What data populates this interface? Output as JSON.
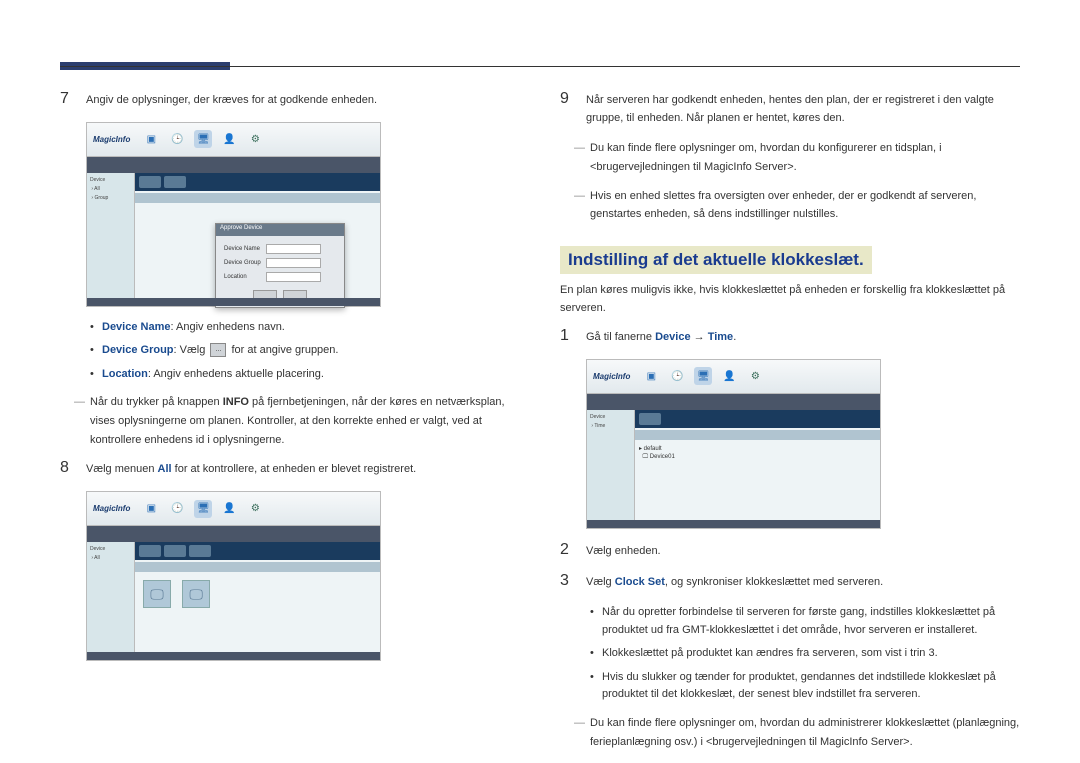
{
  "header": {},
  "left": {
    "step7": {
      "num": "7",
      "text": "Angiv de oplysninger, der kræves for at godkende enheden."
    },
    "screenshot1": {
      "logo": "MagicInfo",
      "dialog_title": "Approve Device",
      "field1_label": "Device Name",
      "field2_label": "Device Group",
      "field3_label": "Location",
      "btn_ok": "OK",
      "btn_cancel": "Cancel"
    },
    "bullets1": {
      "device_name_label": "Device Name",
      "device_name_text": ": Angiv enhedens navn.",
      "device_group_label": "Device Group",
      "device_group_text1": ": Vælg ",
      "device_group_text2": " for at angive gruppen.",
      "group_icon": "...",
      "location_label": "Location",
      "location_text": ": Angiv enhedens aktuelle placering."
    },
    "note1_pre": "Når du trykker på knappen ",
    "note1_info": "INFO",
    "note1_post": " på fjernbetjeningen, når der køres en netværksplan, vises oplysningerne om planen. Kontroller, at den korrekte enhed er valgt, ved at kontrollere enhedens id i oplysningerne.",
    "step8": {
      "num": "8",
      "text_pre": "Vælg menuen ",
      "text_all": "All",
      "text_post": " for at kontrollere, at enheden er blevet registreret."
    },
    "screenshot2": {
      "logo": "MagicInfo"
    }
  },
  "right": {
    "step9": {
      "num": "9",
      "text": "Når serveren har godkendt enheden, hentes den plan, der er registreret i den valgte gruppe, til enheden. Når planen er hentet, køres den."
    },
    "note2": "Du kan finde flere oplysninger om, hvordan du konfigurerer en tidsplan, i <brugervejledningen til MagicInfo Server>.",
    "note3": "Hvis en enhed slettes fra oversigten over enheder, der er godkendt af serveren, genstartes enheden, så dens indstillinger nulstilles.",
    "heading": "Indstilling af det aktuelle klokkeslæt.",
    "subhead": "En plan køres muligvis ikke, hvis klokkeslættet på enheden er forskellig fra klokkeslættet på serveren.",
    "step1": {
      "num": "1",
      "text_pre": "Gå til fanerne ",
      "device": "Device",
      "arrow": " → ",
      "time": "Time",
      "text_post": "."
    },
    "screenshot3": {
      "logo": "MagicInfo",
      "tab_device": "Device",
      "tab_time": "Time"
    },
    "step2": {
      "num": "2",
      "text": "Vælg enheden."
    },
    "step3": {
      "num": "3",
      "text_pre": "Vælg ",
      "clock_set": "Clock Set",
      "text_post": ", og synkroniser klokkeslættet med serveren."
    },
    "bullets2": {
      "b1": "Når du opretter forbindelse til serveren for første gang, indstilles klokkeslættet på produktet ud fra GMT-klokkeslættet i det område, hvor serveren er installeret.",
      "b2": "Klokkeslættet på produktet kan ændres fra serveren, som vist i trin 3.",
      "b3": "Hvis du slukker og tænder for produktet, gendannes det indstillede klokkeslæt på produktet til det klokkeslæt, der senest blev indstillet fra serveren."
    },
    "note4": "Du kan finde flere oplysninger om, hvordan du administrerer klokkeslættet (planlægning, ferieplanlægning osv.) i <brugervejledningen til MagicInfo Server>."
  }
}
